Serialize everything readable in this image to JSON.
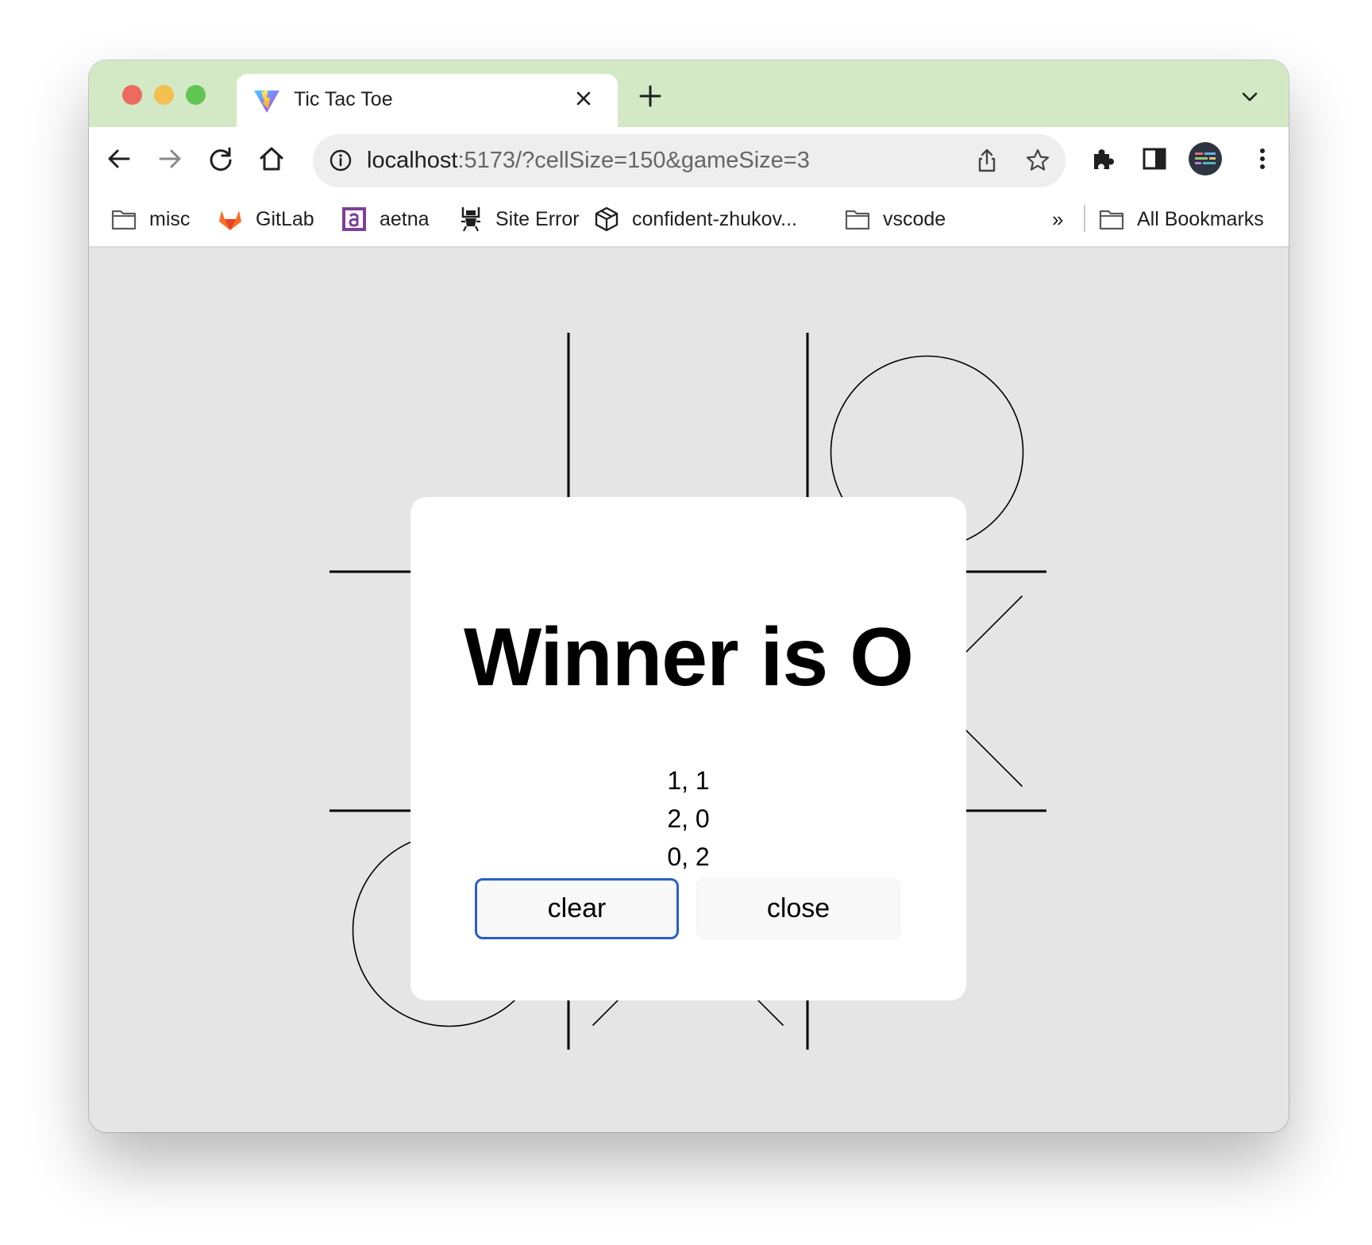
{
  "tab": {
    "title": "Tic Tac Toe",
    "favicon": "vite-icon"
  },
  "address_bar": {
    "host": "localhost",
    "path": ":5173/?cellSize=150&gameSize=3"
  },
  "bookmarks": {
    "items": [
      {
        "label": "misc",
        "icon": "folder-icon"
      },
      {
        "label": "GitLab",
        "icon": "gitlab-icon"
      },
      {
        "label": "aetna",
        "icon": "aetna-icon"
      },
      {
        "label": "Site Error",
        "icon": "site-error-icon"
      },
      {
        "label": "confident-zhukov...",
        "icon": "codesandbox-icon"
      },
      {
        "label": "vscode",
        "icon": "folder-icon"
      }
    ],
    "overflow": "»",
    "all_bookmarks": "All Bookmarks"
  },
  "game": {
    "grid_size": 3,
    "cells": [
      [
        "",
        "",
        "O"
      ],
      [
        "",
        "",
        "X"
      ],
      [
        "O",
        "X",
        ""
      ]
    ]
  },
  "modal": {
    "title": "Winner is O",
    "coords": [
      "1, 1",
      "2, 0",
      "0, 2"
    ],
    "clear_label": "clear",
    "close_label": "close"
  },
  "colors": {
    "tabstrip": "#d3e9c5",
    "page_background": "#e5e5e5",
    "focus_ring": "#2b5fcb"
  }
}
